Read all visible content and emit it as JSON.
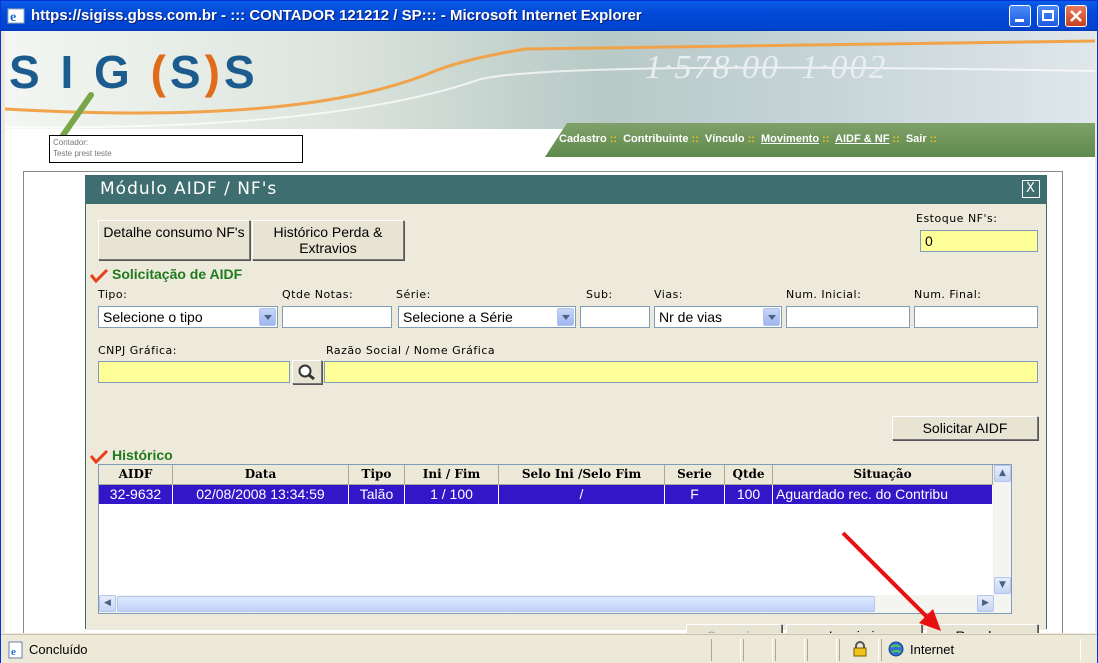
{
  "window": {
    "title": "https://sigiss.gbss.com.br - ::: CONTADOR 121212 / SP::: - Microsoft Internet Explorer"
  },
  "header": {
    "logo": "SIGISS",
    "menu": [
      {
        "label": "Cadastro",
        "active": false
      },
      {
        "label": "Contribuinte",
        "active": false
      },
      {
        "label": "Vínculo",
        "active": false
      },
      {
        "label": "Movimento",
        "active": true
      },
      {
        "label": "AIDF & NF",
        "active": true
      },
      {
        "label": "Sair",
        "active": false
      }
    ],
    "separator": "::",
    "contador_label": "Contador:",
    "contador_value": "Teste prest teste"
  },
  "modal": {
    "title": "Módulo AIDF / NF's",
    "close": "X",
    "btn_detalhe": "Detalhe consumo NF's",
    "btn_historico": "Histórico Perda & Extravios",
    "estoque_label": "Estoque NF's:",
    "estoque_value": "0",
    "section_solicitacao": "Solicitação de AIDF",
    "tipo_label": "Tipo:",
    "tipo_value": "Selecione o tipo",
    "qtde_label": "Qtde Notas:",
    "qtde_value": "",
    "serie_label": "Série:",
    "serie_value": "Selecione a Série",
    "sub_label": "Sub:",
    "sub_value": "",
    "vias_label": "Vias:",
    "vias_value": "Nr de vias",
    "num_inicial_label": "Num. Inicial:",
    "num_inicial_value": "",
    "num_final_label": "Num. Final:",
    "num_final_value": "",
    "cnpj_label": "CNPJ Gráfica:",
    "cnpj_value": "",
    "razao_label": "Razão Social / Nome Gráfica",
    "razao_value": "",
    "btn_solicitar": "Solicitar AIDF",
    "section_historico": "Histórico",
    "table": {
      "headers": [
        "AIDF",
        "Data",
        "Tipo",
        "Ini / Fim",
        "Selo Ini /Selo Fim",
        "Serie",
        "Qtde",
        "Situação"
      ],
      "rows": [
        [
          "32-9632",
          "02/08/2008 13:34:59",
          "Talão",
          "1 / 100",
          "/",
          "F",
          "100",
          "Aguardado rec. do Contribu"
        ]
      ]
    },
    "btn_cancelar": "Cancelar",
    "btn_imprimir": "Imprimir",
    "btn_receber": "Receber"
  },
  "status": {
    "text": "Concluído",
    "zone": "Internet"
  },
  "colors": {
    "titlebar": "#0249d8",
    "modal_header": "#3f6e70",
    "selected_row": "#3316c8",
    "yellow_input": "#ffff99",
    "section_green": "#1f7a1f",
    "arrow_red": "#e81010"
  }
}
